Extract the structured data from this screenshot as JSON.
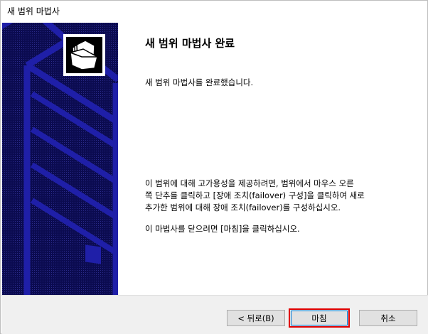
{
  "window": {
    "title": "새 범위 마법사"
  },
  "content": {
    "heading": "새 범위 마법사 완료",
    "intro": "새 범위 마법사를 완료했습니다.",
    "instructions": [
      "이 범위에 대해 고가용성을 제공하려면, 범위에서 마우스 오른",
      "쪽 단추를 클릭하고 [장애 조치(failover) 구성]을 클릭하여 새로",
      "추가한 범위에 대해 장애 조치(failover)를 구성하십시오."
    ],
    "closing": "이 마법사를 닫으려면 [마침]을 클릭하십시오."
  },
  "buttons": {
    "back": "< 뒤로(B)",
    "finish": "마침",
    "cancel": "취소"
  },
  "colors": {
    "side_panel": "#0b0b50",
    "highlight": "#e00000"
  },
  "icons": {
    "wizard": "folder-documents-icon"
  }
}
